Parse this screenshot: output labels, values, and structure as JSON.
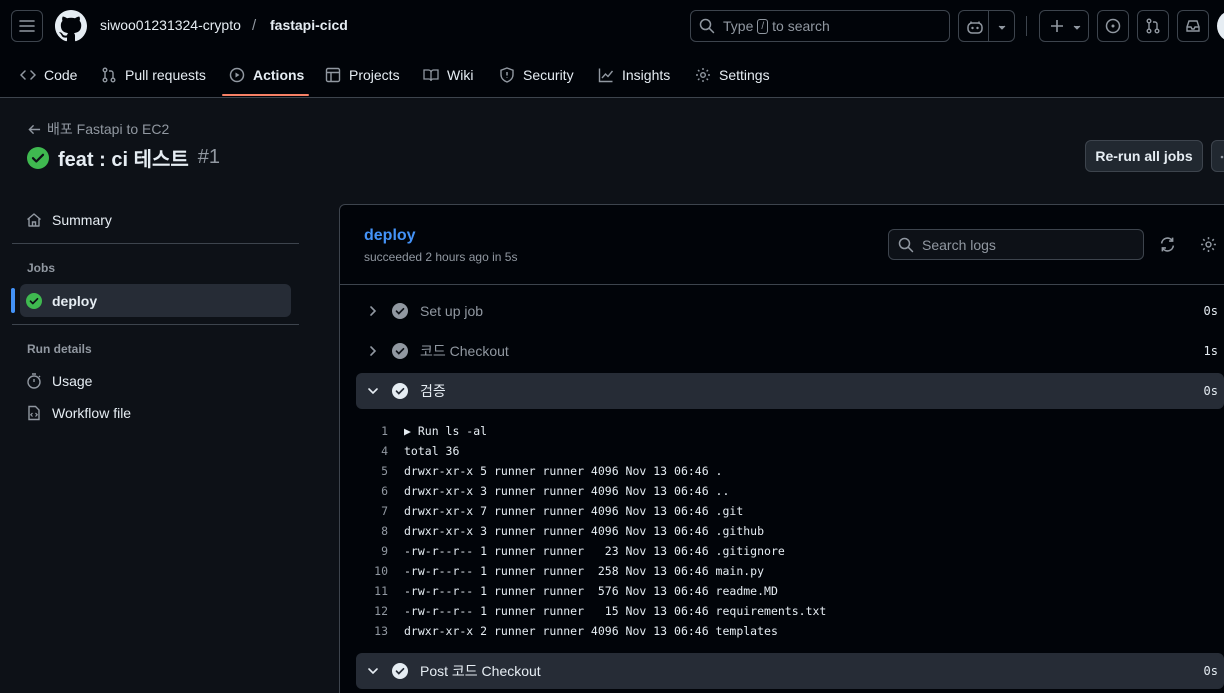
{
  "header": {
    "owner": "siwoo01231324-crypto",
    "separator": "/",
    "repo": "fastapi-cicd",
    "search_prefix": "Type",
    "search_key": "/",
    "search_suffix": "to search"
  },
  "repo_nav": {
    "tabs": [
      {
        "label": "Code",
        "icon": "code-icon"
      },
      {
        "label": "Pull requests",
        "icon": "git-pull-request-icon"
      },
      {
        "label": "Actions",
        "icon": "play-icon",
        "active": true
      },
      {
        "label": "Projects",
        "icon": "table-icon"
      },
      {
        "label": "Wiki",
        "icon": "book-icon"
      },
      {
        "label": "Security",
        "icon": "shield-icon"
      },
      {
        "label": "Insights",
        "icon": "graph-icon"
      },
      {
        "label": "Settings",
        "icon": "gear-icon"
      }
    ]
  },
  "run": {
    "back_label": "배포 Fastapi to EC2",
    "title": "feat : ci 테스트",
    "number": "#1",
    "rerun_label": "Re-run all jobs"
  },
  "sidebar": {
    "summary_label": "Summary",
    "jobs_heading": "Jobs",
    "job_label": "deploy",
    "run_details_heading": "Run details",
    "usage_label": "Usage",
    "workflow_file_label": "Workflow file"
  },
  "job": {
    "name": "deploy",
    "status": "succeeded 2 hours ago in 5s",
    "search_placeholder": "Search logs"
  },
  "steps": [
    {
      "name": "Set up job",
      "duration": "0s",
      "open": false
    },
    {
      "name": "코드 Checkout",
      "duration": "1s",
      "open": false
    },
    {
      "name": "검증",
      "duration": "0s",
      "open": true
    },
    {
      "name": "Post 코드 Checkout",
      "duration": "0s",
      "open": true
    }
  ],
  "log_lines": [
    {
      "n": "1",
      "text": "▶ Run ls -al"
    },
    {
      "n": "4",
      "text": "total 36"
    },
    {
      "n": "5",
      "text": "drwxr-xr-x 5 runner runner 4096 Nov 13 06:46 ."
    },
    {
      "n": "6",
      "text": "drwxr-xr-x 3 runner runner 4096 Nov 13 06:46 .."
    },
    {
      "n": "7",
      "text": "drwxr-xr-x 7 runner runner 4096 Nov 13 06:46 .git"
    },
    {
      "n": "8",
      "text": "drwxr-xr-x 3 runner runner 4096 Nov 13 06:46 .github"
    },
    {
      "n": "9",
      "text": "-rw-r--r-- 1 runner runner   23 Nov 13 06:46 .gitignore"
    },
    {
      "n": "10",
      "text": "-rw-r--r-- 1 runner runner  258 Nov 13 06:46 main.py"
    },
    {
      "n": "11",
      "text": "-rw-r--r-- 1 runner runner  576 Nov 13 06:46 readme.MD"
    },
    {
      "n": "12",
      "text": "-rw-r--r-- 1 runner runner   15 Nov 13 06:46 requirements.txt"
    },
    {
      "n": "13",
      "text": "drwxr-xr-x 2 runner runner 4096 Nov 13 06:46 templates"
    }
  ],
  "colors": {
    "accent_link": "#4493f8",
    "success": "#3fb950",
    "tab_underline": "#f78166",
    "background": "#0d1117"
  }
}
